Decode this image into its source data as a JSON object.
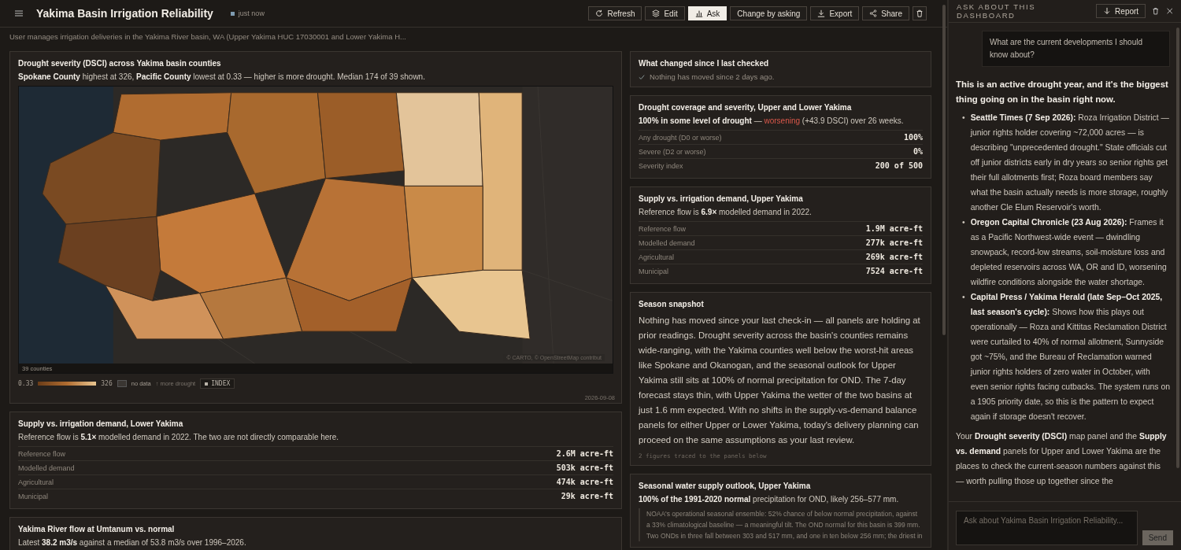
{
  "header": {
    "title": "Yakima Basin Irrigation Reliability",
    "status": "just now",
    "actions": [
      {
        "label": "Refresh",
        "selected": false
      },
      {
        "label": "Edit",
        "selected": false
      },
      {
        "label": "Ask",
        "selected": true
      },
      {
        "label": "Change by asking",
        "selected": false
      },
      {
        "label": "Export",
        "selected": false
      },
      {
        "label": "Share",
        "selected": false
      }
    ]
  },
  "subtitle": "User manages irrigation deliveries in the Yakima River basin, WA (Upper Yakima HUC 17030001 and Lower Yakima H...",
  "map_panel": {
    "title": "Drought severity (DSCI) across Yakima basin counties",
    "summary": "**Spokane County** highest at 326, **Pacific County** lowest at 0.33 — higher is more drought. Median 174 of 39 shown.",
    "count": "39 counties",
    "attribution": "© CARTO, © OpenStreetMap contribut",
    "legend": {
      "min": "0.33",
      "max": "326",
      "no_data": "no data",
      "direction": "↑ more drought",
      "toggle": "INDEX"
    },
    "date": "2026-09-08"
  },
  "supply_lower": {
    "title": "Supply vs. irrigation demand, Lower Yakima",
    "summary": "Reference flow is **5.1×** modelled demand in 2022. The two are not directly comparable here.",
    "rows": [
      {
        "label": "Reference flow",
        "value": "2.6M acre-ft"
      },
      {
        "label": "Modelled demand",
        "value": "503k acre-ft"
      },
      {
        "label": "Agricultural",
        "value": "474k acre-ft"
      },
      {
        "label": "Municipal",
        "value": "29k acre-ft"
      }
    ]
  },
  "river_flow": {
    "title": "Yakima River flow at Umtanum vs. normal",
    "summary": "Latest **38.2 m3/s** against a median of 53.8 m3/s over 1996–2026."
  },
  "what_changed": {
    "title": "What changed since I last checked",
    "note": "Nothing has moved since 2 days ago."
  },
  "drought_coverage": {
    "title": "Drought coverage and severity, Upper and Lower Yakima",
    "lead": "100% in some level of drought",
    "separator": "—",
    "trend": "worsening",
    "rest": "(+43.9 DSCI) over 26 weeks.",
    "rows": [
      {
        "label": "Any drought (D0 or worse)",
        "value": "100%"
      },
      {
        "label": "Severe (D2 or worse)",
        "value": "0%"
      },
      {
        "label": "Severity index",
        "value": "200 of 500"
      }
    ]
  },
  "supply_upper": {
    "title": "Supply vs. irrigation demand, Upper Yakima",
    "summary": "Reference flow is **6.9×** modelled demand in 2022.",
    "rows": [
      {
        "label": "Reference flow",
        "value": "1.9M acre-ft"
      },
      {
        "label": "Modelled demand",
        "value": "277k acre-ft"
      },
      {
        "label": "Agricultural",
        "value": "269k acre-ft"
      },
      {
        "label": "Municipal",
        "value": "7524 acre-ft"
      }
    ]
  },
  "snapshot": {
    "title": "Season snapshot",
    "body": "Nothing has moved since your last check-in — all panels are holding at prior readings. Drought severity across the basin's counties remains wide-ranging, with the Yakima counties well below the worst-hit areas like Spokane and Okanogan, and the seasonal outlook for Upper Yakima still sits at 100% of normal precipitation for OND. The 7-day forecast stays thin, with Upper Yakima the wetter of the two basins at just 1.6 mm expected. With no shifts in the supply-vs-demand balance panels for either Upper or Lower Yakima, today's delivery planning can proceed on the same assumptions as your last review.",
    "trace": "2 figures traced to the panels below"
  },
  "outlook": {
    "title": "Seasonal water supply outlook, Upper Yakima",
    "summary": "**100% of the 1991-2020 normal** precipitation for OND, likely 256–577 mm.",
    "quote": "NOAA's operational seasonal ensemble: 52% chance of below normal precipitation, against a 33% climatological baseline — a meaningful tilt. The OND normal for this basin is 399 mm. Two ONDs in three fall between 303 and 517 mm, and one in ten below 256 mm; the driest in"
  },
  "chat": {
    "title": "ASK ABOUT THIS DASHBOARD",
    "report": "Report",
    "question": "What are the current developments I should know about?",
    "intro": "This is an active drought year, and it's the biggest thing going on in the basin right now.",
    "bullets": [
      {
        "marker": "•",
        "text": "**Seattle Times (7 Sep 2026):** Roza Irrigation District — junior rights holder covering ~72,000 acres — is describing \"unprecedented drought.\" State officials cut off junior districts early in dry years so senior rights get their full allotments first; Roza board members say what the basin actually needs is more storage, roughly another Cle Elum Reservoir's worth."
      },
      {
        "marker": "•",
        "text": "**Oregon Capital Chronicle (23 Aug 2026):** Frames it as a Pacific Northwest-wide event — dwindling snowpack, record-low streams, soil-moisture loss and depleted reservoirs across WA, OR and ID, worsening wildfire conditions alongside the water shortage."
      },
      {
        "marker": "•",
        "text": "**Capital Press / Yakima Herald (late Sep–Oct 2025, last season's cycle):** Shows how this plays out operationally — Roza and Kittitas Reclamation District were curtailed to 40% of normal allotment, Sunnyside got ~75%, and the Bureau of Reclamation warned junior rights holders of zero water in October, with even senior rights facing cutbacks. The system runs on a 1905 priority date, so this is the pattern to expect again if storage doesn't recover."
      }
    ],
    "closing": "Your **Drought severity (DSCI)** map panel and the **Supply vs. demand** panels for Upper and Lower Yakima are the places to check the current-season numbers against this — worth pulling those up together since the",
    "placeholder": "Ask about Yakima Basin Irrigation Reliability...",
    "send": "Send"
  }
}
